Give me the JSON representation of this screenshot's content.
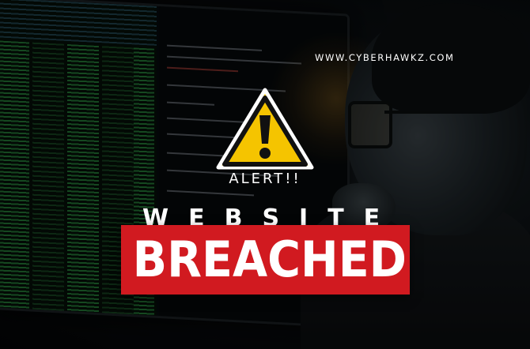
{
  "site_url": "WWW.CYBERHAWKZ.COM",
  "alert_label": "ALERT!!",
  "headline_top": "WEBSITE",
  "headline_main": "BREACHED",
  "icons": [
    "warning-triangle-icon"
  ],
  "colors": {
    "banner_red": "#d11a20",
    "warning_yellow": "#f5c400",
    "code_green": "#3cc85a",
    "text_white": "#ffffff"
  }
}
